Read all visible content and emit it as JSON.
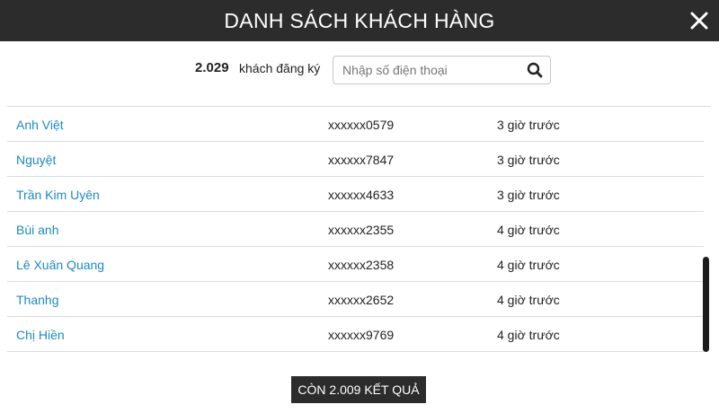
{
  "header": {
    "title": "DANH SÁCH KHÁCH HÀNG",
    "close_icon": "close-icon"
  },
  "toolbar": {
    "count": "2.029",
    "count_label": "khách đăng ký",
    "search_placeholder": "Nhập số điện thoại",
    "search_value": "",
    "search_icon": "search-icon"
  },
  "customers": [
    {
      "name": "Anh Việt",
      "phone": "xxxxxx0579",
      "time": "3 giờ trước"
    },
    {
      "name": "Nguyệt",
      "phone": "xxxxxx7847",
      "time": "3 giờ trước"
    },
    {
      "name": "Trần Kim Uyên",
      "phone": "xxxxxx4633",
      "time": "3 giờ trước"
    },
    {
      "name": "Bùi anh",
      "phone": "xxxxxx2355",
      "time": "4 giờ trước"
    },
    {
      "name": "Lê Xuân Quang",
      "phone": "xxxxxx2358",
      "time": "4 giờ trước"
    },
    {
      "name": "Thanhg",
      "phone": "xxxxxx2652",
      "time": "4 giờ trước"
    },
    {
      "name": "Chị Hiền",
      "phone": "xxxxxx9769",
      "time": "4 giờ trước"
    }
  ],
  "footer": {
    "more_label": "CÒN 2.009 KẾT QUẢ"
  },
  "colors": {
    "header_bg": "#2c2c2c",
    "link": "#1a8ac7",
    "button_bg": "#2c2c2c"
  }
}
